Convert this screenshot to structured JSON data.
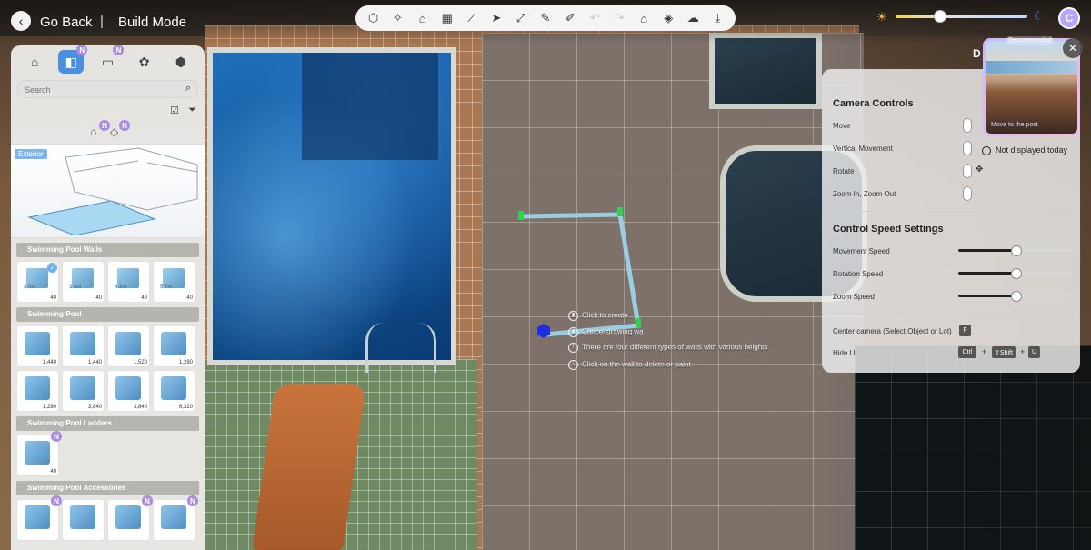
{
  "header": {
    "back_label": "Go Back",
    "separator": "|",
    "mode_title": "Build Mode"
  },
  "toolbar": {
    "tools": [
      {
        "name": "build-object-icon",
        "glyph": "⬡",
        "enabled": true
      },
      {
        "name": "magic-wand-icon",
        "glyph": "✧",
        "enabled": true
      },
      {
        "name": "room-icon",
        "glyph": "⌂",
        "enabled": true
      },
      {
        "name": "grid-icon",
        "glyph": "▦",
        "enabled": true
      },
      {
        "name": "stairs-icon",
        "glyph": "⟋",
        "enabled": true
      },
      {
        "name": "select-cursor-icon",
        "glyph": "➤",
        "enabled": true
      },
      {
        "name": "move-icon",
        "glyph": "⤢",
        "enabled": true
      },
      {
        "name": "eyedropper-icon",
        "glyph": "✎",
        "enabled": true
      },
      {
        "name": "paint-icon",
        "glyph": "✐",
        "enabled": true
      },
      {
        "name": "undo-icon",
        "glyph": "↶",
        "enabled": false
      },
      {
        "name": "redo-icon",
        "glyph": "↷",
        "enabled": false
      },
      {
        "name": "house-settings-icon",
        "glyph": "⌂",
        "enabled": true
      },
      {
        "name": "terrain-icon",
        "glyph": "◈",
        "enabled": true
      },
      {
        "name": "cloud-save-icon",
        "glyph": "☁",
        "enabled": true
      },
      {
        "name": "download-icon",
        "glyph": "⤓",
        "enabled": true
      }
    ]
  },
  "time_of_day": {
    "value": 0.33
  },
  "user": {
    "avatar_letter": "C"
  },
  "left_panel": {
    "tabs": [
      {
        "name": "tab-lots",
        "glyph": "⌂",
        "badge": "",
        "active": false
      },
      {
        "name": "tab-build",
        "glyph": "◧",
        "badge": "N",
        "active": true
      },
      {
        "name": "tab-furniture",
        "glyph": "▭",
        "badge": "N",
        "active": false
      },
      {
        "name": "tab-decor",
        "glyph": "✿",
        "badge": "",
        "active": false
      },
      {
        "name": "tab-packs",
        "glyph": "⬢",
        "badge": "",
        "active": false
      }
    ],
    "search_placeholder": "Search",
    "sub_badges": [
      "N",
      "N"
    ],
    "preview_label": "Exterior",
    "sections": [
      {
        "title": "Swimming Pool Walls",
        "items": [
          {
            "label": "3.0m",
            "price": "40",
            "selected": true,
            "badge": ""
          },
          {
            "label": "3.3m",
            "price": "40",
            "selected": false,
            "badge": ""
          },
          {
            "label": "4.2m",
            "price": "40",
            "selected": false,
            "badge": ""
          },
          {
            "label": "5.7m",
            "price": "40",
            "selected": false,
            "badge": ""
          }
        ]
      },
      {
        "title": "Swimming Pool",
        "items": [
          {
            "label": "",
            "price": "1,440",
            "selected": false,
            "badge": ""
          },
          {
            "label": "",
            "price": "1,440",
            "selected": false,
            "badge": ""
          },
          {
            "label": "",
            "price": "1,520",
            "selected": false,
            "badge": ""
          },
          {
            "label": "",
            "price": "1,280",
            "selected": false,
            "badge": ""
          },
          {
            "label": "",
            "price": "1,280",
            "selected": false,
            "badge": ""
          },
          {
            "label": "",
            "price": "3,840",
            "selected": false,
            "badge": ""
          },
          {
            "label": "",
            "price": "3,840",
            "selected": false,
            "badge": ""
          },
          {
            "label": "",
            "price": "6,320",
            "selected": false,
            "badge": ""
          }
        ]
      },
      {
        "title": "Swimming Pool Ladders",
        "items": [
          {
            "label": "",
            "price": "40",
            "selected": false,
            "badge": "N"
          }
        ]
      },
      {
        "title": "Swimming Pool Accessories",
        "items": [
          {
            "label": "",
            "price": "",
            "selected": false,
            "badge": "N"
          },
          {
            "label": "",
            "price": "",
            "selected": false,
            "badge": ""
          },
          {
            "label": "",
            "price": "",
            "selected": false,
            "badge": "N"
          },
          {
            "label": "",
            "price": "",
            "selected": false,
            "badge": "N"
          }
        ]
      }
    ]
  },
  "hints": [
    {
      "text": "Click to create",
      "icon": "mouse-left-icon"
    },
    {
      "text": "Cancel drawing wa",
      "icon": "mouse-right-icon"
    },
    {
      "text": "There are four different types of walls with various heights",
      "icon": "info-icon"
    },
    {
      "text": "Click on the wall to delete or paint",
      "icon": "info-icon"
    }
  ],
  "controls_panel": {
    "camera_title": "Camera Controls",
    "camera_rows": [
      {
        "label": "Move"
      },
      {
        "label": "Vertical Movement"
      },
      {
        "label": "Rotate"
      },
      {
        "label": "Zoom In, Zoom Out"
      }
    ],
    "speed_title": "Control Speed Settings",
    "speed_rows": [
      {
        "label": "Movement Speed",
        "value": 0.5
      },
      {
        "label": "Rotation Speed",
        "value": 0.5
      },
      {
        "label": "Zoom Speed",
        "value": 0.5
      }
    ],
    "center_label": "Center camera (Select Object or Lot)",
    "center_key": "F",
    "hide_label": "Hide UI",
    "hide_keys": [
      "Ctrl",
      "⇧Shift",
      "U"
    ],
    "plus": "+"
  },
  "recommended": {
    "tag": "Recommended",
    "move_text": "Move to the post",
    "dont_show": "Not displayed today",
    "peek_letter": "D"
  }
}
